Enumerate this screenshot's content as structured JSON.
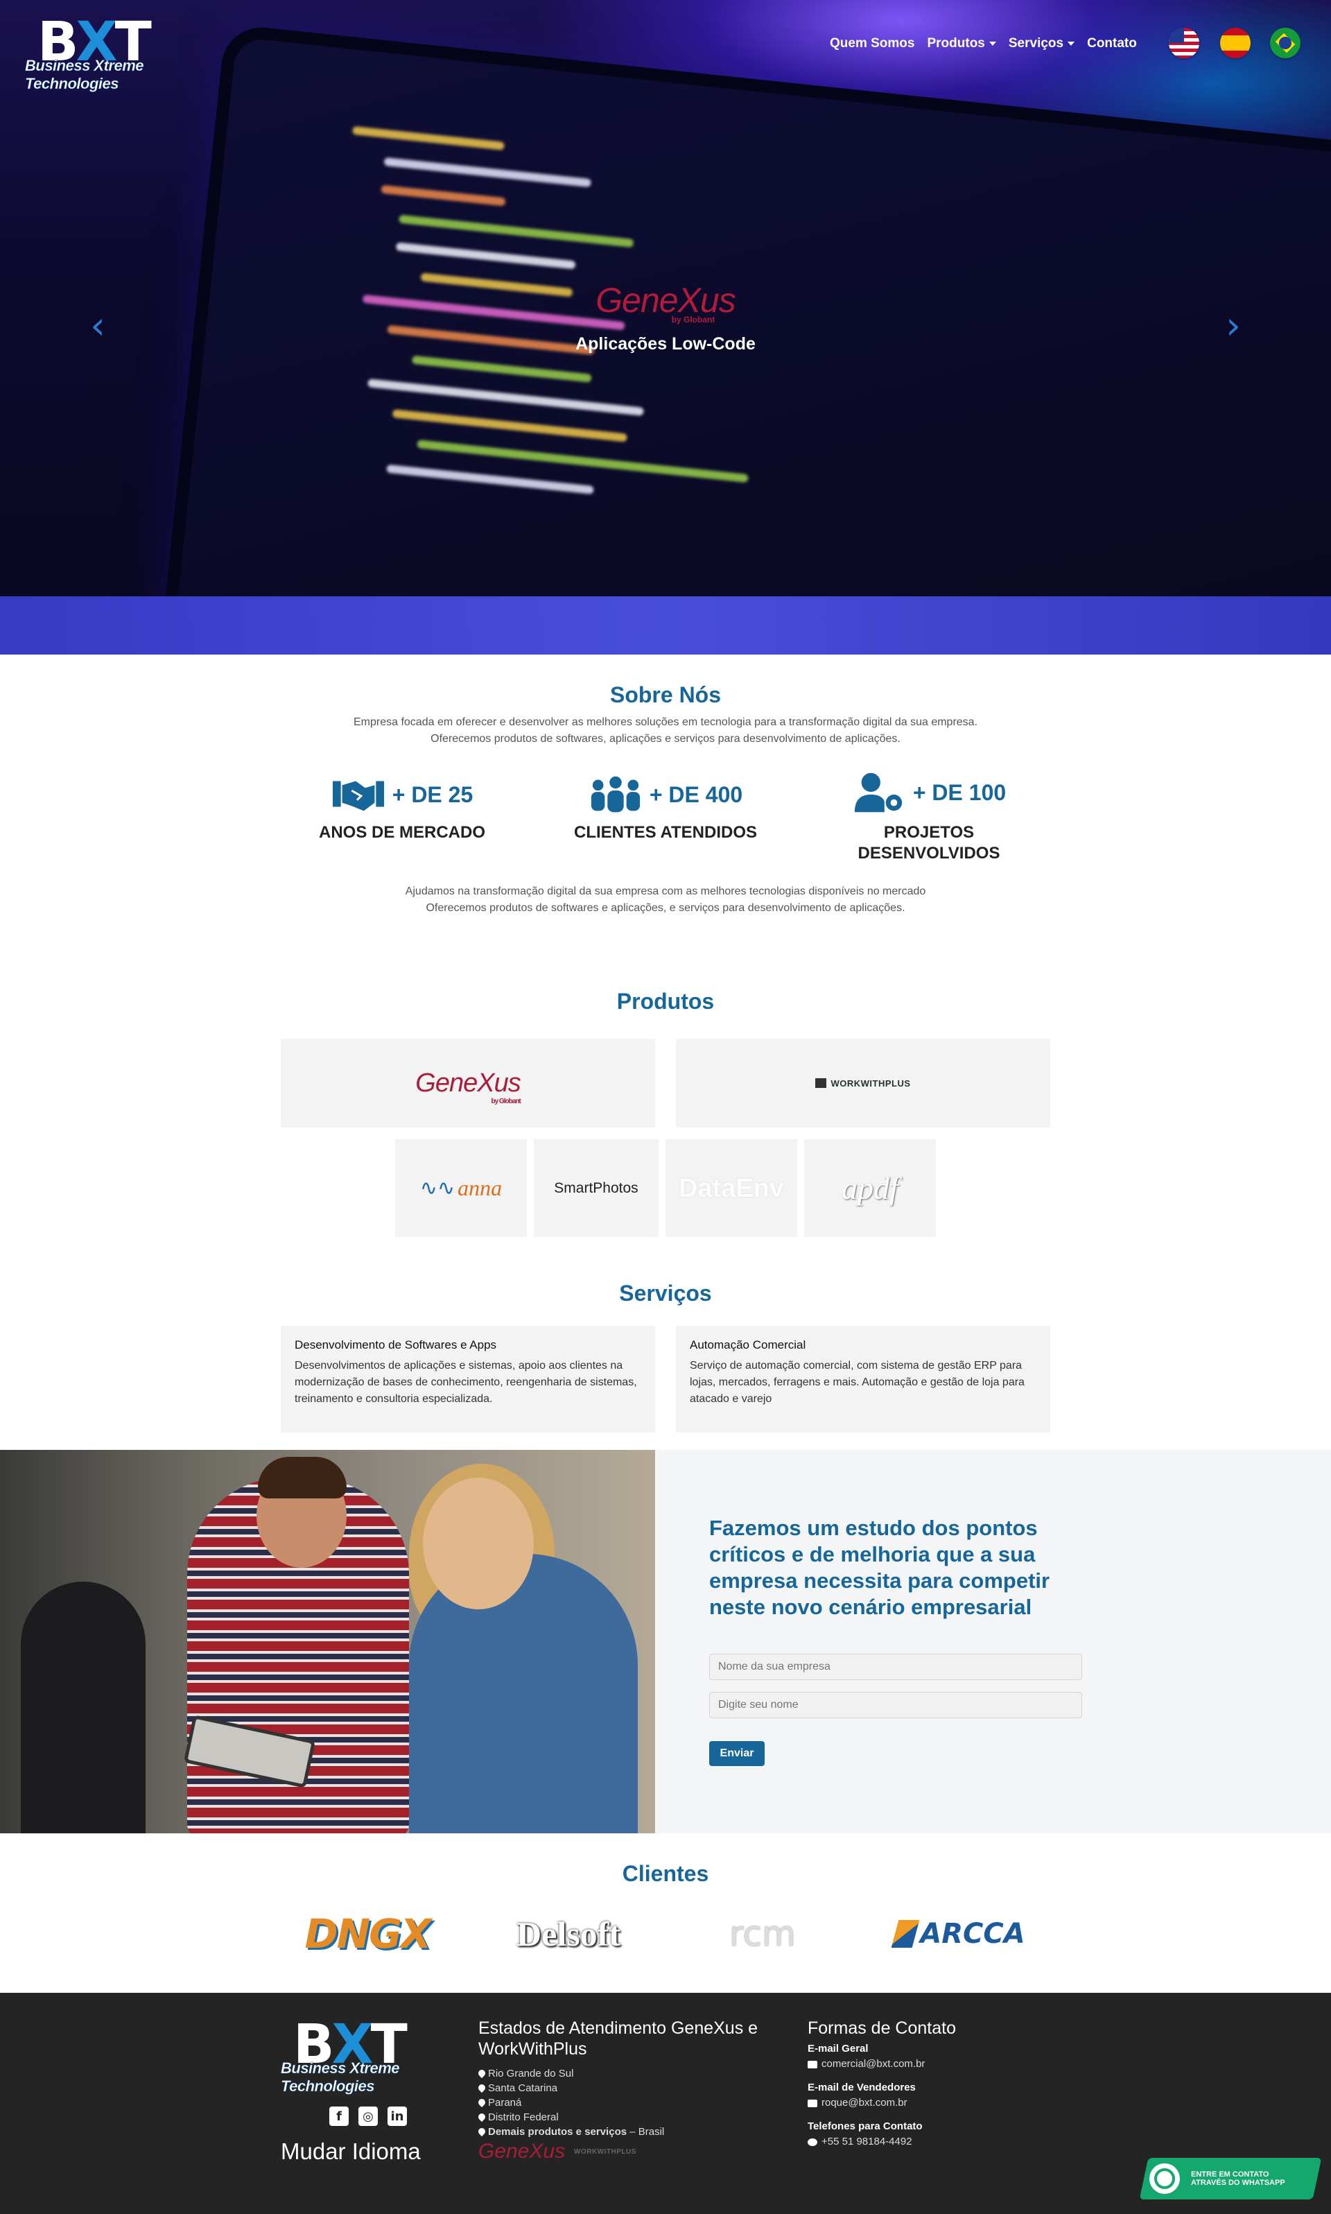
{
  "brand": {
    "logo_big": "BXT",
    "logo_x": "X",
    "logo_small": "Business Xtreme Technologies"
  },
  "nav": {
    "items": [
      {
        "label": "Quem Somos"
      },
      {
        "label": "Produtos"
      },
      {
        "label": "Serviços"
      },
      {
        "label": "Contato"
      }
    ],
    "flags": [
      "us-flag-icon",
      "es-flag-icon",
      "br-flag-icon"
    ]
  },
  "hero": {
    "brand": "GeneXus",
    "brand_by": "by Globant",
    "caption": "Aplicações Low-Code",
    "prev": "‹",
    "next": "›"
  },
  "about": {
    "title": "Sobre Nós",
    "text1": "Empresa focada em oferecer e desenvolver as melhores soluções em tecnologia para a transformação digital da sua empresa.",
    "text2": "Oferecemos produtos de softwares, aplicações e serviços para desenvolvimento de aplicações.",
    "stats": [
      {
        "value": "+ DE  25",
        "label1": "ANOS DE MERCADO",
        "label2": ""
      },
      {
        "value": "+ DE  400",
        "label1": "CLIENTES ATENDIDOS",
        "label2": ""
      },
      {
        "value": "+ DE  100",
        "label1": "PROJETOS",
        "label2": "DESENVOLVIDOS"
      }
    ],
    "text3": "Ajudamos na transformação digital da sua empresa com as melhores tecnologias disponíveis no mercado",
    "text4": "Oferecemos produtos de softwares e aplicações, e serviços para desenvolvimento de aplicações."
  },
  "products": {
    "title": "Produtos",
    "genexus": "GeneXus",
    "genexus_by": "by Globant",
    "wwp": "WORKWITHPLUS",
    "anna": "anna",
    "smartphotos": "SmartPhotos",
    "dataenv": "DataEnv",
    "apdf": "apdf"
  },
  "services": {
    "title": "Serviços",
    "cards": [
      {
        "title": "Desenvolvimento de Softwares e Apps",
        "text": "Desenvolvimentos de aplicações e sistemas, apoio aos clientes na modernização de bases de conhecimento, reengenharia de sistemas, treinamento e consultoria especializada."
      },
      {
        "title": "Automação Comercial",
        "text": "Serviço de automação comercial, com sistema de gestão ERP para lojas, mercados, ferragens e mais. Automação e gestão de loja para atacado e varejo"
      }
    ]
  },
  "cta": {
    "title": "Fazemos um estudo dos pontos críticos e de melhoria que a sua empresa necessita para competir neste novo cenário empresarial",
    "company_placeholder": "Nome da sua empresa",
    "name_placeholder": "Digite seu nome",
    "submit": "Enviar"
  },
  "clients": {
    "title": "Clientes",
    "logos": [
      "DNGX",
      "Delsoft",
      "rcm",
      "ARCCA"
    ]
  },
  "footer": {
    "states_title": "Estados de Atendimento GeneXus e WorkWithPlus",
    "states": [
      "Rio Grande do Sul",
      "Santa Catarina",
      "Paraná",
      "Distrito Federal"
    ],
    "more_bold": "Demais produtos e serviços",
    "more_rest": " – Brasil",
    "contact_title": "Formas de Contato",
    "email_label": "E-mail Geral",
    "email": "comercial@bxt.com.br",
    "sales_label": "E-mail de Vendedores",
    "sales_email": "roque@bxt.com.br",
    "phone_label": "Telefones para Contato",
    "phone": "+55 51 98184-4492",
    "language": "Mudar Idioma",
    "gx": "GeneXus",
    "wwp": "WORKWITHPLUS",
    "social": [
      "f",
      "◎",
      "in"
    ]
  },
  "whatsapp": {
    "line1": "Entre em contato",
    "line2": "através do WhatsApp"
  },
  "colors": {
    "accent": "#17669a",
    "whatsapp": "#14a76e",
    "footer_bg": "#242424"
  }
}
